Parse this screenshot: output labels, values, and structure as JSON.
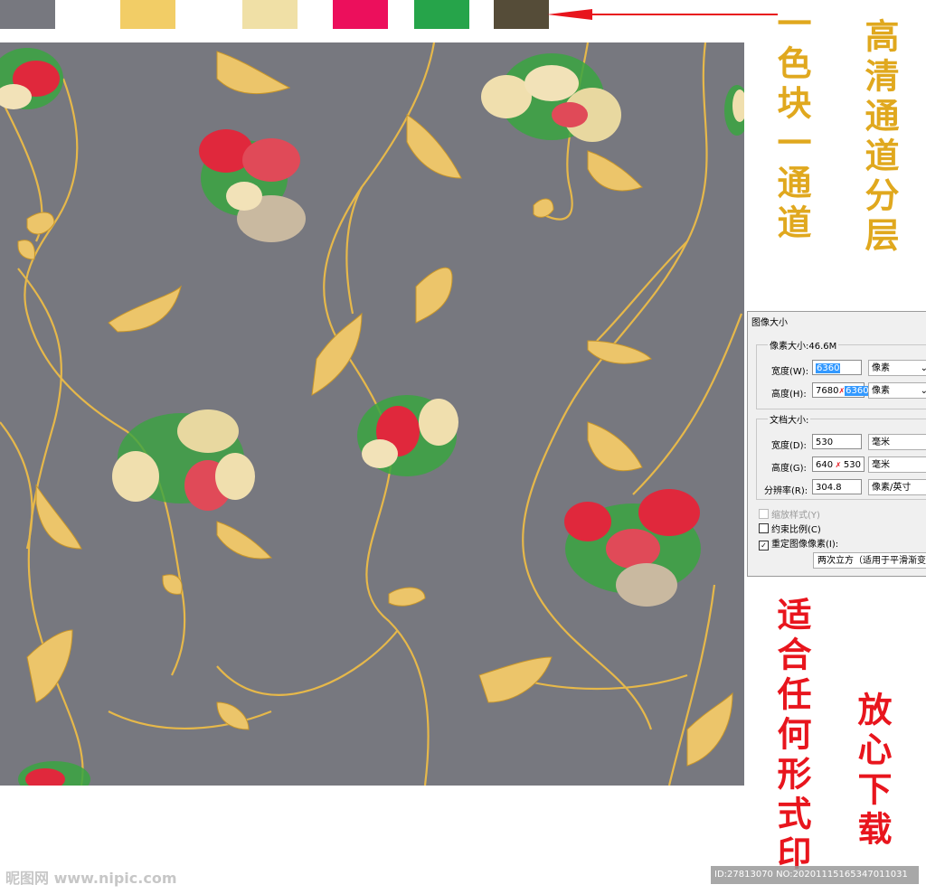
{
  "swatches": [
    {
      "color": "#77787f"
    },
    {
      "color": "#ffffff"
    },
    {
      "color": "#f2cd66"
    },
    {
      "color": "#f0e0a6"
    },
    {
      "color": "#ec0f5c"
    },
    {
      "color": "#26a44a"
    },
    {
      "color": "#554c38"
    }
  ],
  "pattern": {
    "background": "#77787f",
    "accent_gold": "#e6b84a",
    "accent_red": "#e0283c",
    "accent_green": "#3aa441"
  },
  "captions": {
    "left_gold": "一色块一通道",
    "right_gold": "高清通道分层",
    "left_red": "适合任何形式印",
    "right_red": "放心下载"
  },
  "dialog": {
    "title": "图像大小",
    "pixel_size_label": "像素大小:46.6M",
    "width_label": "宽度(W):",
    "width_value": "6360",
    "width_unit": "像素",
    "height_label": "高度(H):",
    "height_old": "7680",
    "height_value": "6360",
    "height_unit": "像素",
    "doc_size_label": "文档大小:",
    "doc_width_label": "宽度(D):",
    "doc_width_value": "530",
    "doc_width_unit": "毫米",
    "doc_height_label": "高度(G):",
    "doc_height_old": "640",
    "doc_height_value": "530",
    "doc_height_unit": "毫米",
    "resolution_label": "分辨率(R):",
    "resolution_value": "304.8",
    "resolution_unit": "像素/英寸",
    "scale_styles": "缩放样式(Y)",
    "constrain": "约束比例(C)",
    "resample": "重定图像像素(I):",
    "resample_method": "两次立方（适用于平滑渐变"
  },
  "watermark": "昵图网 www.nipic.com",
  "id_text": "ID:27813070 NO:20201115165347011031"
}
